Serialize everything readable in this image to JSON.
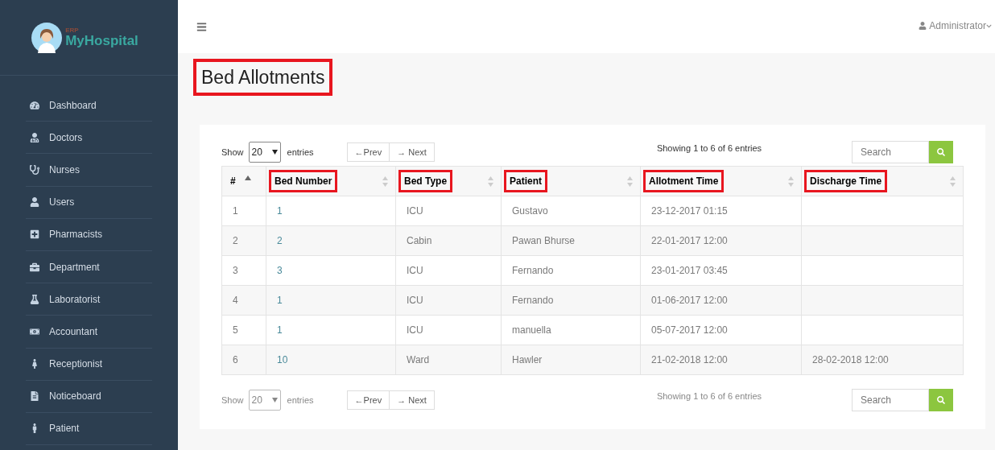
{
  "sidebar": {
    "logo": {
      "tag": "ERP",
      "name": "MyHospital"
    },
    "items": [
      {
        "label": "Dashboard"
      },
      {
        "label": "Doctors"
      },
      {
        "label": "Nurses"
      },
      {
        "label": "Users"
      },
      {
        "label": "Pharmacists"
      },
      {
        "label": "Department"
      },
      {
        "label": "Laboratorist"
      },
      {
        "label": "Accountant"
      },
      {
        "label": "Receptionist"
      },
      {
        "label": "Noticeboard"
      },
      {
        "label": "Patient"
      }
    ]
  },
  "topbar": {
    "user": "Administrator"
  },
  "page_title": {
    "text": "Bed Allotments",
    "highlighted": true
  },
  "top_controls": {
    "show": "Show",
    "page_size": "20",
    "entries": "entries",
    "prev": "←Prev",
    "next": "→ Next",
    "info": "Showing 1 to 6 of 6 entries",
    "search_placeholder": "Search"
  },
  "table": {
    "columns": [
      {
        "label": "#",
        "sorted": true,
        "highlighted": false
      },
      {
        "label": "Bed Number",
        "sorted": false,
        "highlighted": true
      },
      {
        "label": "Bed Type",
        "sorted": false,
        "highlighted": true
      },
      {
        "label": "Patient",
        "sorted": false,
        "highlighted": true
      },
      {
        "label": "Allotment Time",
        "sorted": false,
        "highlighted": true
      },
      {
        "label": "Discharge Time",
        "sorted": false,
        "highlighted": true
      }
    ],
    "rows": [
      [
        "1",
        "1",
        "ICU",
        "Gustavo",
        "23-12-2017 01:15",
        ""
      ],
      [
        "2",
        "2",
        "Cabin",
        "Pawan Bhurse",
        "22-01-2017 12:00",
        ""
      ],
      [
        "3",
        "3",
        "ICU",
        "Fernando",
        "23-01-2017 03:45",
        ""
      ],
      [
        "4",
        "1",
        "ICU",
        "Fernando",
        "01-06-2017 12:00",
        ""
      ],
      [
        "5",
        "1",
        "ICU",
        "manuella",
        "05-07-2017 12:00",
        ""
      ],
      [
        "6",
        "10",
        "Ward",
        "Hawler",
        "21-02-2018 12:00",
        "28-02-2018 12:00"
      ]
    ]
  },
  "bottom_controls": {
    "show": "Show",
    "page_size": "20",
    "entries": "entries",
    "prev": "←Prev",
    "next": "→ Next",
    "info": "Showing 1 to 6 of 6 entries",
    "search_placeholder": "Search"
  }
}
